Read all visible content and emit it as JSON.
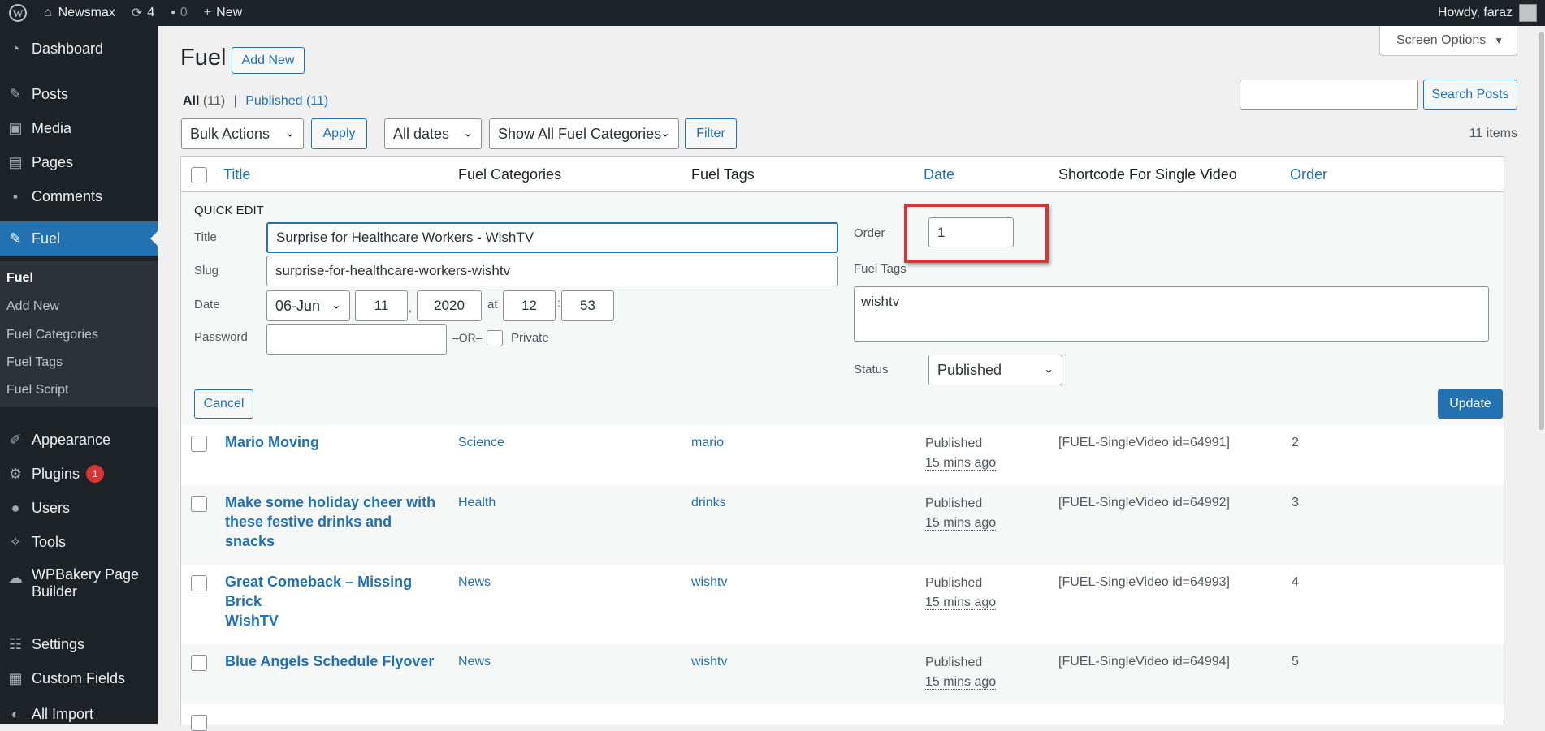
{
  "adminbar": {
    "site_name": "Newsmax",
    "updates_count": "4",
    "comments_count": "0",
    "new_label": "New",
    "greeting": "Howdy, faraz"
  },
  "sidebar": {
    "items": [
      {
        "label": "Dashboard",
        "icon": "dashboard-icon"
      },
      {
        "label": "Posts",
        "icon": "pin-icon"
      },
      {
        "label": "Media",
        "icon": "media-icon"
      },
      {
        "label": "Pages",
        "icon": "pages-icon"
      },
      {
        "label": "Comments",
        "icon": "comments-icon"
      },
      {
        "label": "Fuel",
        "icon": "pin-icon"
      },
      {
        "label": "Appearance",
        "icon": "brush-icon"
      },
      {
        "label": "Plugins",
        "icon": "plugin-icon",
        "badge": "1"
      },
      {
        "label": "Users",
        "icon": "users-icon"
      },
      {
        "label": "Tools",
        "icon": "wrench-icon"
      },
      {
        "label": "WPBakery Page",
        "label2": "Builder",
        "icon": "cloud-icon"
      },
      {
        "label": "Settings",
        "icon": "settings-icon"
      },
      {
        "label": "Custom Fields",
        "icon": "grid-icon"
      },
      {
        "label": "All Import",
        "icon": "import-icon"
      }
    ],
    "submenu": [
      "Fuel",
      "Add New",
      "Fuel Categories",
      "Fuel Tags",
      "Fuel Script"
    ]
  },
  "page": {
    "title": "Fuel",
    "add_new": "Add New",
    "screen_options": "Screen Options",
    "filter_all": "All",
    "filter_all_count": "(11)",
    "filter_sep": "|",
    "filter_published": "Published",
    "filter_published_count": "(11)",
    "search_button": "Search Posts",
    "search_value": "",
    "bulk_actions": "Bulk Actions",
    "apply": "Apply",
    "all_dates": "All dates",
    "categories_filter": "Show All Fuel Categories",
    "filter_button": "Filter",
    "items_count": "11 items"
  },
  "table": {
    "headers": {
      "title": "Title",
      "categories": "Fuel Categories",
      "tags": "Fuel Tags",
      "date": "Date",
      "shortcode": "Shortcode For Single Video",
      "order": "Order"
    },
    "rows": [
      {
        "title": "Mario Moving",
        "title2": "",
        "category": "Science",
        "tag": "mario",
        "status": "Published",
        "ago": "15 mins ago",
        "shortcode": "[FUEL-SingleVideo id=64991]",
        "order": "2"
      },
      {
        "title": "Make some holiday cheer with",
        "title2": "these festive drinks and snacks",
        "category": "Health",
        "tag": "drinks",
        "status": "Published",
        "ago": "15 mins ago",
        "shortcode": "[FUEL-SingleVideo id=64992]",
        "order": "3"
      },
      {
        "title": "Great Comeback – Missing Brick",
        "title2": "WishTV",
        "category": "News",
        "tag": "wishtv",
        "status": "Published",
        "ago": "15 mins ago",
        "shortcode": "[FUEL-SingleVideo id=64993]",
        "order": "4"
      },
      {
        "title": "Blue Angels Schedule Flyover",
        "title2": "",
        "category": "News",
        "tag": "wishtv",
        "status": "Published",
        "ago": "15 mins ago",
        "shortcode": "[FUEL-SingleVideo id=64994]",
        "order": "5"
      }
    ]
  },
  "quick_edit": {
    "heading": "QUICK EDIT",
    "title_label": "Title",
    "title_value": "Surprise for Healthcare Workers - WishTV",
    "slug_label": "Slug",
    "slug_value": "surprise-for-healthcare-workers-wishtv",
    "date_label": "Date",
    "month": "06-Jun",
    "day": "11",
    "year": "2020",
    "at": "at",
    "hour": "12",
    "minute": "53",
    "password_label": "Password",
    "password_value": "",
    "or": "–OR–",
    "private_label": "Private",
    "order_label": "Order",
    "order_value": "1",
    "tags_label": "Fuel Tags",
    "tags_value": "wishtv",
    "status_label": "Status",
    "status_value": "Published",
    "cancel": "Cancel",
    "update": "Update"
  },
  "colors": {
    "accent": "#2271b1",
    "highlight": "#d63638"
  }
}
